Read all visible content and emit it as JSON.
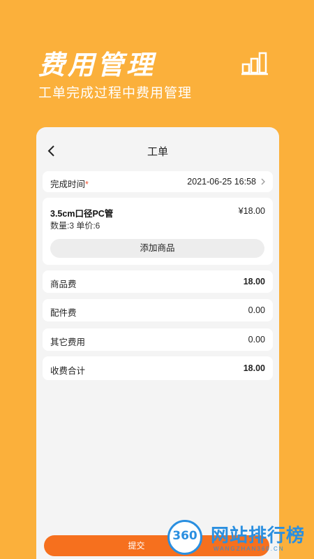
{
  "hero": {
    "title": "费用管理",
    "subtitle": "工单完成过程中费用管理",
    "icon": "bar-chart-icon"
  },
  "screen": {
    "title": "工单",
    "back_icon": "chevron-left-icon"
  },
  "completion": {
    "label": "完成时间",
    "required_mark": "*",
    "value": "2021-06-25 16:58"
  },
  "product": {
    "name": "3.5cm口径PC管",
    "price": "¥18.00",
    "meta": "数量:3 单价:6",
    "add_label": "添加商品"
  },
  "fees": {
    "goods_label": "商品费",
    "goods_value": "18.00",
    "parts_label": "配件费",
    "parts_value": "0.00",
    "other_label": "其它费用",
    "other_value": "0.00",
    "total_label": "收费合计",
    "total_value": "18.00"
  },
  "submit_label": "提交",
  "watermark": {
    "badge": "360",
    "name": "网站排行榜",
    "url": "WANGZHAN360.CN"
  },
  "colors": {
    "background": "#FBB03B",
    "accent": "#F6701E",
    "required": "#F0502F",
    "watermark": "#2A8FE0"
  }
}
